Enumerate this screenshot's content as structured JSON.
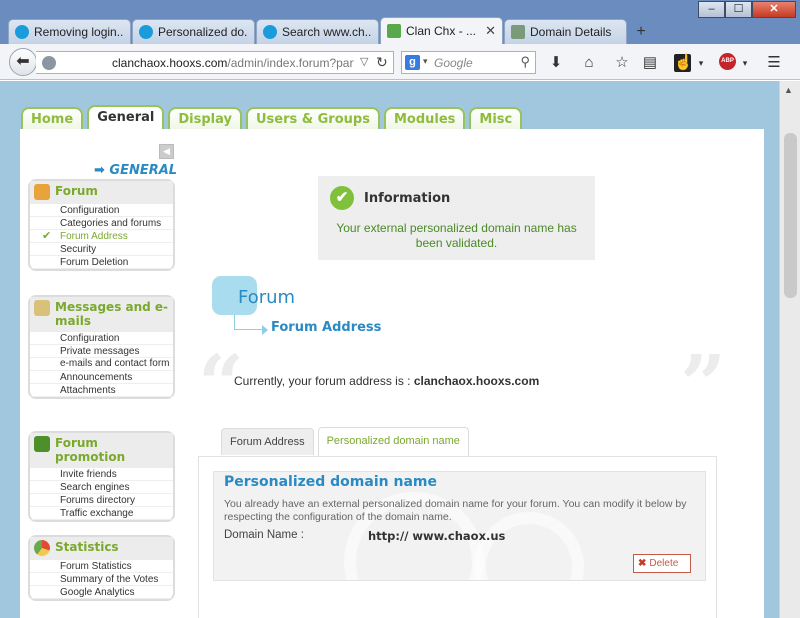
{
  "browser": {
    "window_controls": {
      "minimize": "–",
      "maximize": "☐",
      "close": "✕"
    },
    "tabs": [
      {
        "label": "Removing login...",
        "active": false,
        "icon": "chat-bubble-icon"
      },
      {
        "label": "Personalized do...",
        "active": false,
        "icon": "chat-bubble-icon"
      },
      {
        "label": "Search www.ch...",
        "active": false,
        "icon": "chat-bubble-icon"
      },
      {
        "label": "Clan Chx - ...",
        "active": true,
        "icon": "green-chat-icon"
      },
      {
        "label": "Domain Details",
        "active": false,
        "icon": "domain-page-icon"
      }
    ],
    "new_tab": "+",
    "url": {
      "host": "clanchaox.hooxs.com",
      "path": "/admin/index.forum?part=ge"
    },
    "search": {
      "engine_letter": "g",
      "placeholder": "Google"
    }
  },
  "admin_tabs": [
    {
      "label": "Home",
      "active": false
    },
    {
      "label": "General",
      "active": true
    },
    {
      "label": "Display",
      "active": false
    },
    {
      "label": "Users & Groups",
      "active": false
    },
    {
      "label": "Modules",
      "active": false
    },
    {
      "label": "Misc",
      "active": false
    }
  ],
  "sidebar": {
    "section_title": "➡ GENERAL",
    "collapse": "◀",
    "boxes": [
      {
        "title": "Forum",
        "icon": "wrench-icon",
        "items": [
          {
            "label": "Configuration",
            "active": false
          },
          {
            "label": "Categories and forums",
            "active": false
          },
          {
            "label": "Forum Address",
            "active": true
          },
          {
            "label": "Security",
            "active": false
          },
          {
            "label": "Forum Deletion",
            "active": false
          }
        ]
      },
      {
        "title": "Messages and e-mails",
        "icon": "document-icon",
        "items": [
          {
            "label": "Configuration",
            "active": false
          },
          {
            "label": "Private messages",
            "active": false
          },
          {
            "label": "e-mails and contact form",
            "active": false
          },
          {
            "label": "Announcements",
            "active": false
          },
          {
            "label": "Attachments",
            "active": false
          }
        ]
      },
      {
        "title": "Forum promotion",
        "icon": "megaphone-icon",
        "items": [
          {
            "label": "Invite friends",
            "active": false
          },
          {
            "label": "Search engines",
            "active": false
          },
          {
            "label": "Forums directory",
            "active": false
          },
          {
            "label": "Traffic exchange",
            "active": false
          }
        ]
      },
      {
        "title": "Statistics",
        "icon": "pie-chart-icon",
        "items": [
          {
            "label": "Forum Statistics",
            "active": false
          },
          {
            "label": "Summary of the Votes",
            "active": false
          },
          {
            "label": "Google Analytics",
            "active": false
          }
        ]
      }
    ]
  },
  "info": {
    "title": "Information",
    "message": "Your external personalized domain name has been validated."
  },
  "page": {
    "title": "Forum",
    "subtitle": "Forum Address",
    "current_prefix": "Currently, your forum address is :",
    "current_value": "clanchaox.hooxs.com",
    "quote_open": "“",
    "quote_close": "”"
  },
  "sub_tabs": [
    {
      "label": "Forum Address",
      "active": false
    },
    {
      "label": "Personalized domain name",
      "active": true
    }
  ],
  "domain": {
    "heading": "Personalized domain name",
    "description": "You already have an external personalized domain name for your forum. You can modify it below by respecting the configuration of the domain name.",
    "label": "Domain Name :",
    "value": "http:// www.chaox.us",
    "delete_label": "Delete"
  },
  "colors": {
    "accent_green": "#7aa92c",
    "accent_blue": "#2a8ac4",
    "page_bg": "#a0c7de"
  }
}
